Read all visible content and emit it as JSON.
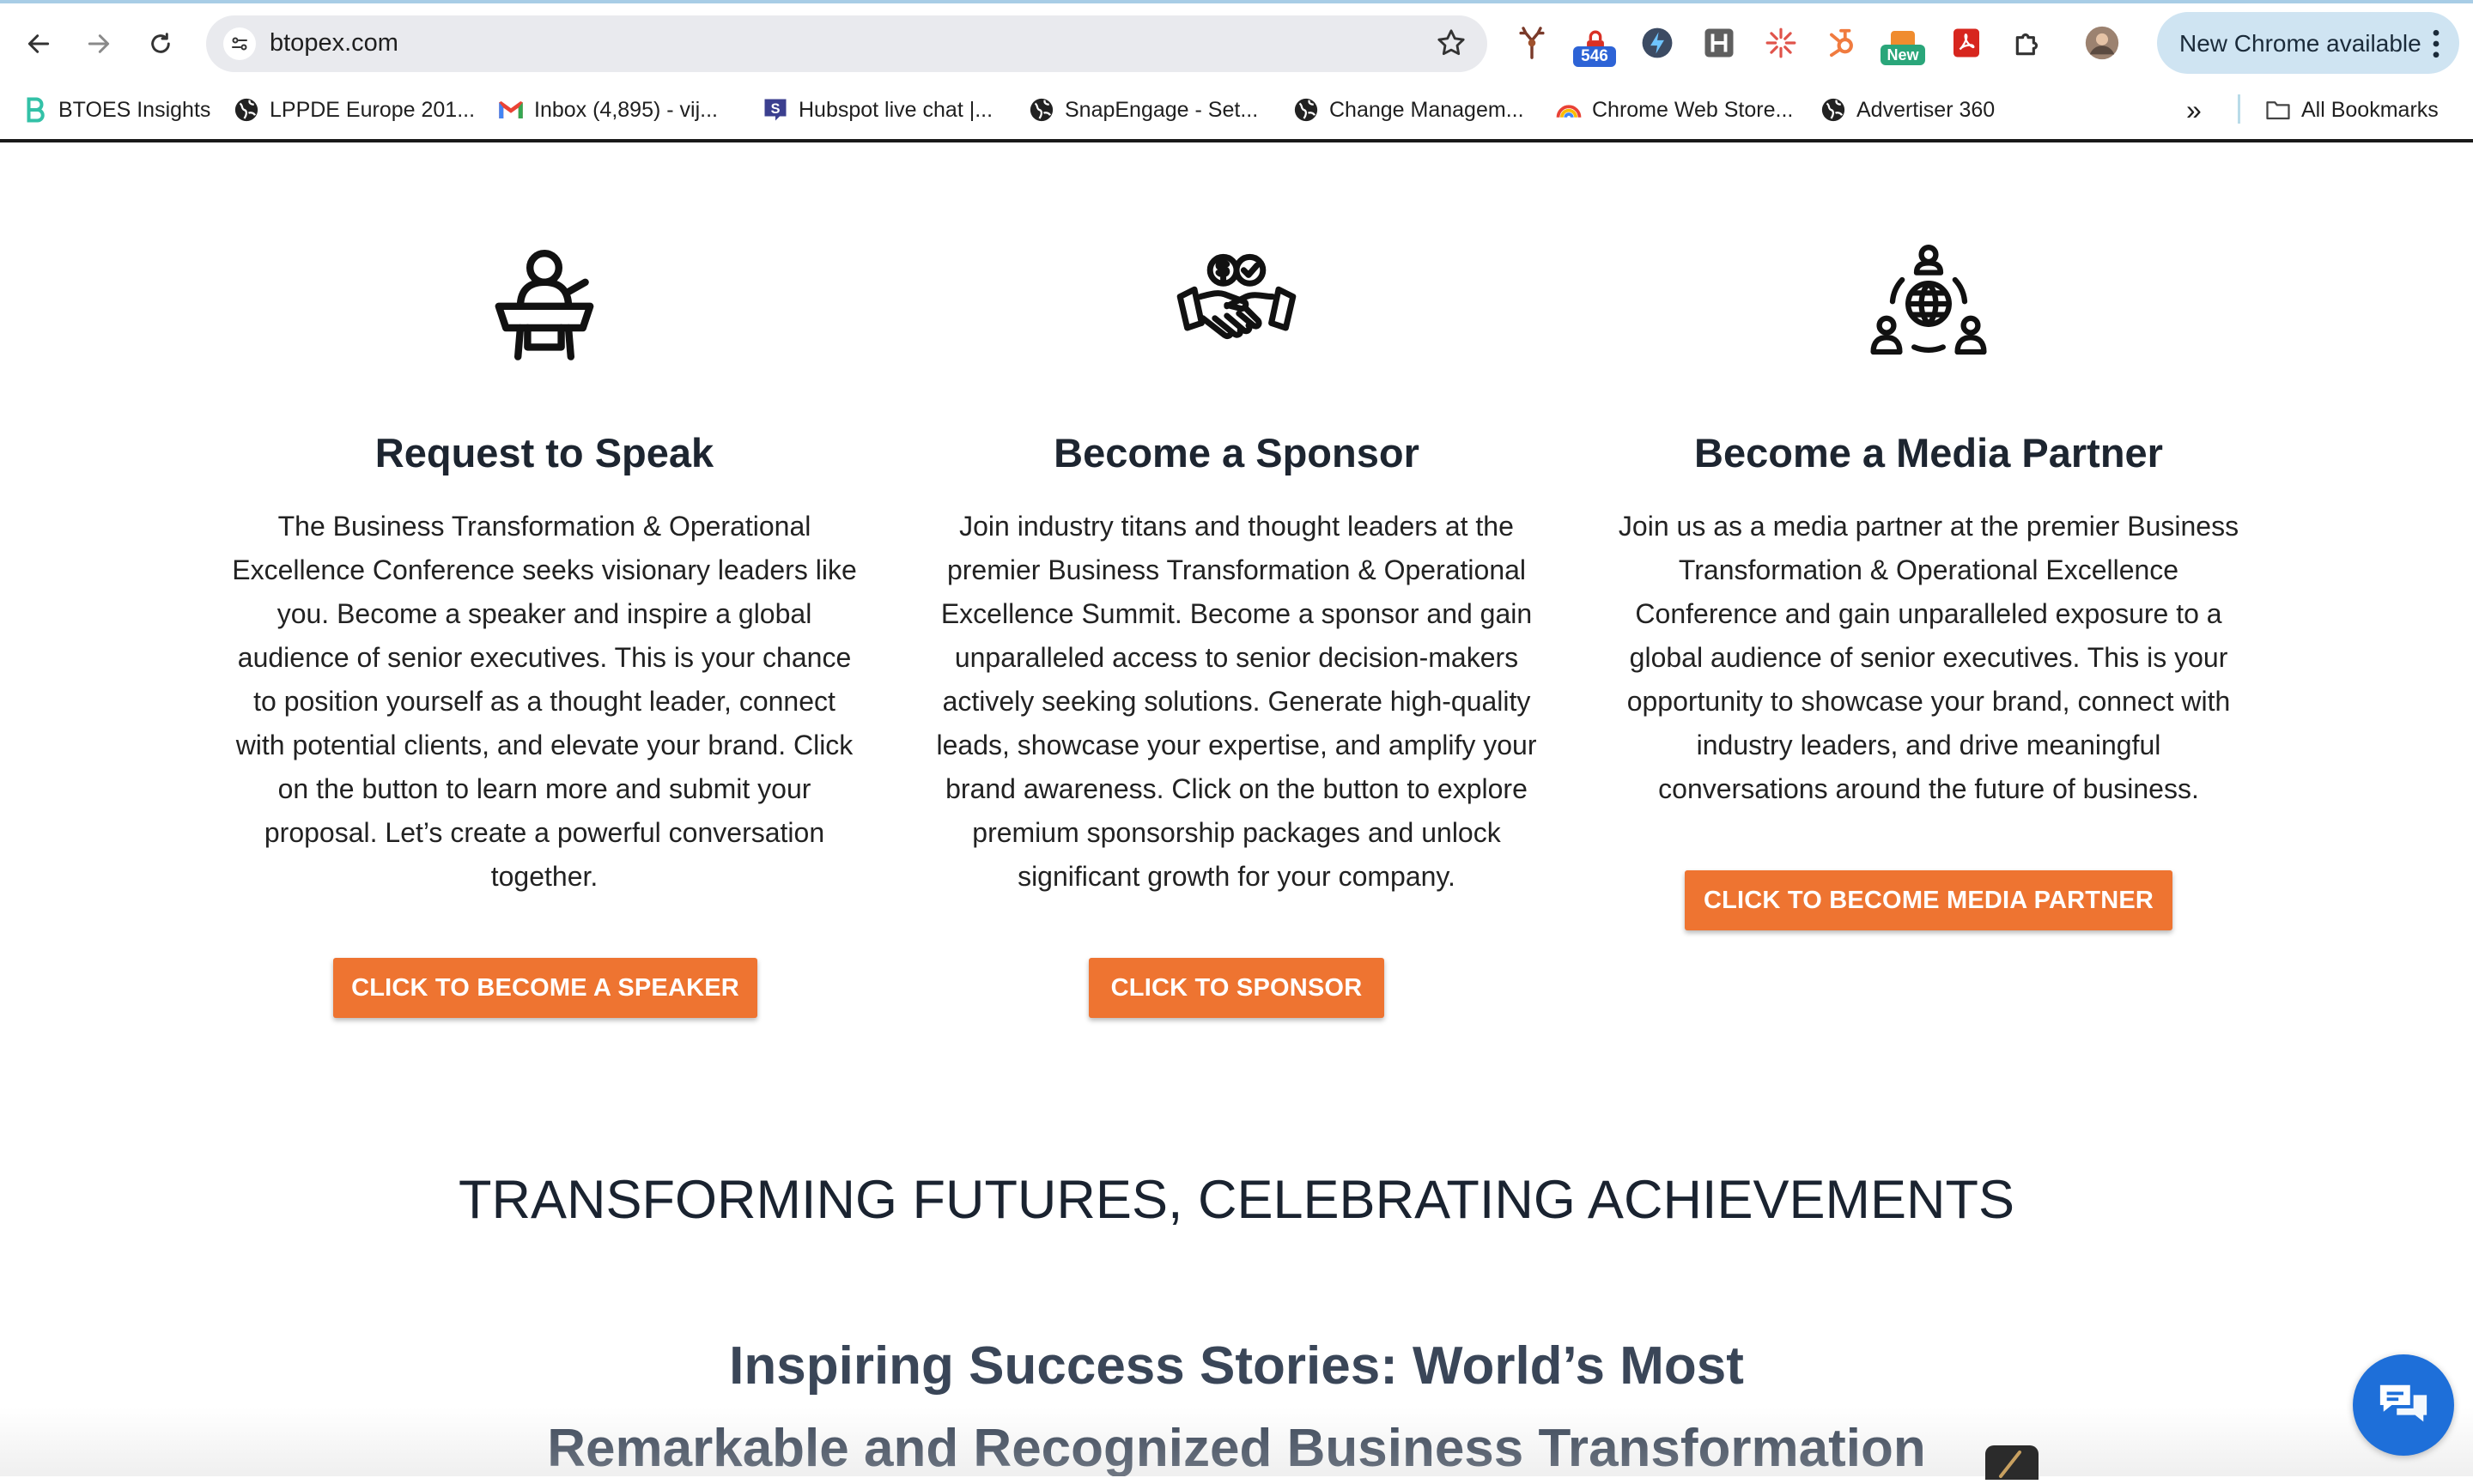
{
  "browser": {
    "url": "btopex.com",
    "extension_badges": {
      "counter": "546",
      "new": "New"
    },
    "update_label": "New Chrome available",
    "bookmarks": [
      {
        "label": "BTOES Insights",
        "icon": "btoes-logo-icon"
      },
      {
        "label": "LPPDE Europe 201...",
        "icon": "globe-icon"
      },
      {
        "label": "Inbox (4,895) - vij...",
        "icon": "gmail-icon"
      },
      {
        "label": "Hubspot live chat |...",
        "icon": "s-logo-icon"
      },
      {
        "label": "SnapEngage - Set...",
        "icon": "globe-icon"
      },
      {
        "label": "Change Managem...",
        "icon": "globe-icon"
      },
      {
        "label": "Chrome Web Store...",
        "icon": "rainbow-icon"
      },
      {
        "label": "Advertiser 360",
        "icon": "globe-icon"
      }
    ],
    "more_label": "»",
    "all_bookmarks": "All Bookmarks"
  },
  "page": {
    "cards": [
      {
        "title": "Request to Speak",
        "icon": "speaker-podium-icon",
        "text": "The Business Transformation & Operational Excellence Conference seeks visionary leaders like you. Become a speaker and inspire a global audience of senior executives.  This is your chance to position yourself as a thought leader, connect with potential clients, and elevate your brand. Click on the button to learn more and submit your proposal. Let’s create a powerful conversation together.",
        "button": "CLICK TO BECOME A SPEAKER"
      },
      {
        "title": "Become a Sponsor",
        "icon": "handshake-money-icon",
        "text": "Join industry titans and thought leaders at the premier Business Transformation & Operational Excellence Summit.  Become a sponsor and gain unparalleled access to senior decision-makers actively seeking solutions. Generate high-quality leads, showcase your expertise, and amplify your brand awareness.  Click on the button to explore premium sponsorship packages and unlock significant growth for your company.",
        "button": "CLICK TO SPONSOR"
      },
      {
        "title": "Become a Media Partner",
        "icon": "globe-network-people-icon",
        "text": "Join us as a media partner at the premier Business Transformation & Operational Excellence Conference and gain unparalleled exposure to a global audience of senior executives. This is your opportunity to showcase your brand, connect with industry leaders, and drive meaningful conversations around the future of business.",
        "button": "CLICK TO BECOME MEDIA PARTNER"
      }
    ],
    "headline": "TRANSFORMING FUTURES, CELEBRATING ACHIEVEMENTS",
    "subheadline_line1": "Inspiring Success Stories: World’s Most",
    "subheadline_line2": "Remarkable and Recognized Business Transformation"
  },
  "colors": {
    "accent": "#ee7431",
    "chat": "#1e6fd9",
    "heading": "#1d2530",
    "subheading": "#3a4658"
  }
}
